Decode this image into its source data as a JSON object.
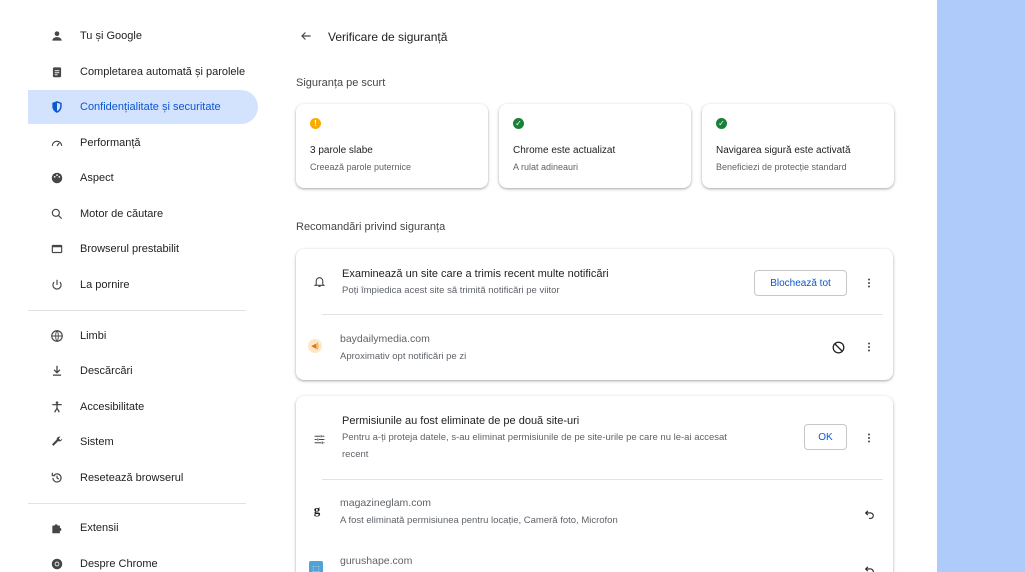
{
  "sidebar": {
    "items": [
      {
        "label": "Tu și Google",
        "icon": "person-icon"
      },
      {
        "label": "Completarea automată și parolele",
        "icon": "clipboard-icon"
      },
      {
        "label": "Confidențialitate și securitate",
        "icon": "shield-icon",
        "active": true
      },
      {
        "label": "Performanță",
        "icon": "speedometer-icon"
      },
      {
        "label": "Aspect",
        "icon": "palette-icon"
      },
      {
        "label": "Motor de căutare",
        "icon": "search-icon"
      },
      {
        "label": "Browserul prestabilit",
        "icon": "browser-icon"
      },
      {
        "label": "La pornire",
        "icon": "power-icon"
      },
      {
        "label": "Limbi",
        "icon": "globe-icon"
      },
      {
        "label": "Descărcări",
        "icon": "download-icon"
      },
      {
        "label": "Accesibilitate",
        "icon": "accessibility-icon"
      },
      {
        "label": "Sistem",
        "icon": "wrench-icon"
      },
      {
        "label": "Resetează browserul",
        "icon": "reset-icon"
      },
      {
        "label": "Extensii",
        "icon": "puzzle-icon"
      },
      {
        "label": "Despre Chrome",
        "icon": "chrome-icon"
      }
    ]
  },
  "header": {
    "title": "Verificare de siguranță"
  },
  "summary": {
    "title": "Siguranța pe scurt",
    "cards": [
      {
        "title": "3 parole slabe",
        "subtitle": "Creează parole puternice",
        "status": "warning",
        "color": "#f9ab00"
      },
      {
        "title": "Chrome este actualizat",
        "subtitle": "A rulat adineauri",
        "status": "ok",
        "color": "#188038"
      },
      {
        "title": "Navigarea sigură este activată",
        "subtitle": "Beneficiezi de protecție standard",
        "status": "ok",
        "color": "#188038"
      }
    ]
  },
  "recommendations": {
    "title": "Recomandări privind siguranța",
    "notifications": {
      "title": "Examinează un site care a trimis recent multe notificări",
      "subtitle": "Poți împiedica acest site să trimită notificări pe viitor",
      "button": "Blochează tot",
      "site": {
        "name": "baydailymedia.com",
        "desc": "Aproximativ opt notificări pe zi"
      }
    },
    "permissions": {
      "title": "Permisiunile au fost eliminate de pe două site-uri",
      "subtitle_line1": "Pentru a-ți proteja datele, s-au eliminat permisiunile de pe site-urile pe care nu le-ai accesat",
      "subtitle_line2": "recent",
      "button": "OK",
      "sites": [
        {
          "name": "magazineglam.com",
          "desc": "A fost eliminată permisiunea pentru locație, Cameră foto, Microfon",
          "favicon": "g"
        },
        {
          "name": "gurushape.com",
          "desc": ""
        }
      ]
    }
  },
  "colors": {
    "accent": "#0b57d0",
    "active_bg": "#d3e3fd",
    "right_panel": "#aecbfa"
  }
}
